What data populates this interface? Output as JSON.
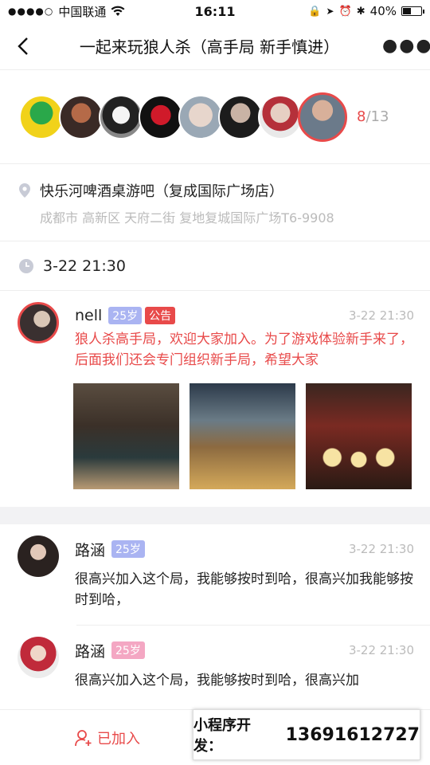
{
  "status_bar": {
    "carrier": "中国联通",
    "time": "16:11",
    "battery": "40%",
    "battery_level": 0.4
  },
  "nav": {
    "back_icon": "chevron-left-icon",
    "title": "一起来玩狼人杀（高手局 新手慎进）",
    "more_icon": "more-dots-icon"
  },
  "members": {
    "current": "8",
    "total": "/13"
  },
  "location": {
    "name": "快乐河啤酒桌游吧（复成国际广场店）",
    "address": "成都市 高新区 天府二街 复地复城国际广场T6-9908"
  },
  "event_time": "3-22 21:30",
  "posts": [
    {
      "name": "nell",
      "age": "25岁",
      "notice_badge": "公告",
      "time": "3-22 21:30",
      "text": "狼人杀高手局，欢迎大家加入。为了游戏体验新手来了，后面我们还会专门组织新手局，希望大家"
    },
    {
      "name": "路涵",
      "age": "25岁",
      "time": "3-22 21:30",
      "text": "很高兴加入这个局，我能够按时到哈，很高兴加我能够按时到哈，"
    },
    {
      "name": "路涵",
      "age": "25岁",
      "time": "3-22 21:30",
      "text": "很高兴加入这个局，我能够按时到哈，很高兴加"
    }
  ],
  "bottom": {
    "joined_label": "已加入",
    "ad_label": "小程序开发：",
    "ad_phone": "13691612727"
  },
  "colors": {
    "accent": "#e84a4a",
    "age_blue": "#aab4f2",
    "age_pink": "#f4a7c3"
  }
}
